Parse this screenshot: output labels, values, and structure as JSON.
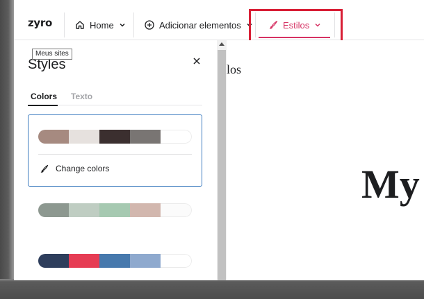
{
  "header": {
    "logo": "zyro",
    "nav": {
      "home_label": "Home",
      "add_label": "Adicionar elementos",
      "styles_label": "Estilos"
    },
    "active_color": "#d63163",
    "highlight_color": "#d81e35"
  },
  "tooltip": "Meus sites",
  "panel": {
    "title": "Styles",
    "tabs": [
      {
        "label": "Colors",
        "active": true
      },
      {
        "label": "Texto",
        "active": false
      }
    ],
    "change_colors_label": "Change colors",
    "palettes": [
      {
        "selected": true,
        "colors": [
          "#a68a80",
          "#e6e1de",
          "#3b2f2f",
          "#797573",
          "#ffffff"
        ]
      },
      {
        "selected": false,
        "colors": [
          "#8d9890",
          "#bfcdc2",
          "#a6c9b1",
          "#d2b7ae",
          "#fbfbfb"
        ]
      },
      {
        "selected": false,
        "colors": [
          "#2e3e5c",
          "#e63c54",
          "#4779ad",
          "#8ea9ce",
          "#ffffff"
        ]
      }
    ]
  },
  "canvas": {
    "partial_text": "los",
    "heading_partial": "My"
  }
}
